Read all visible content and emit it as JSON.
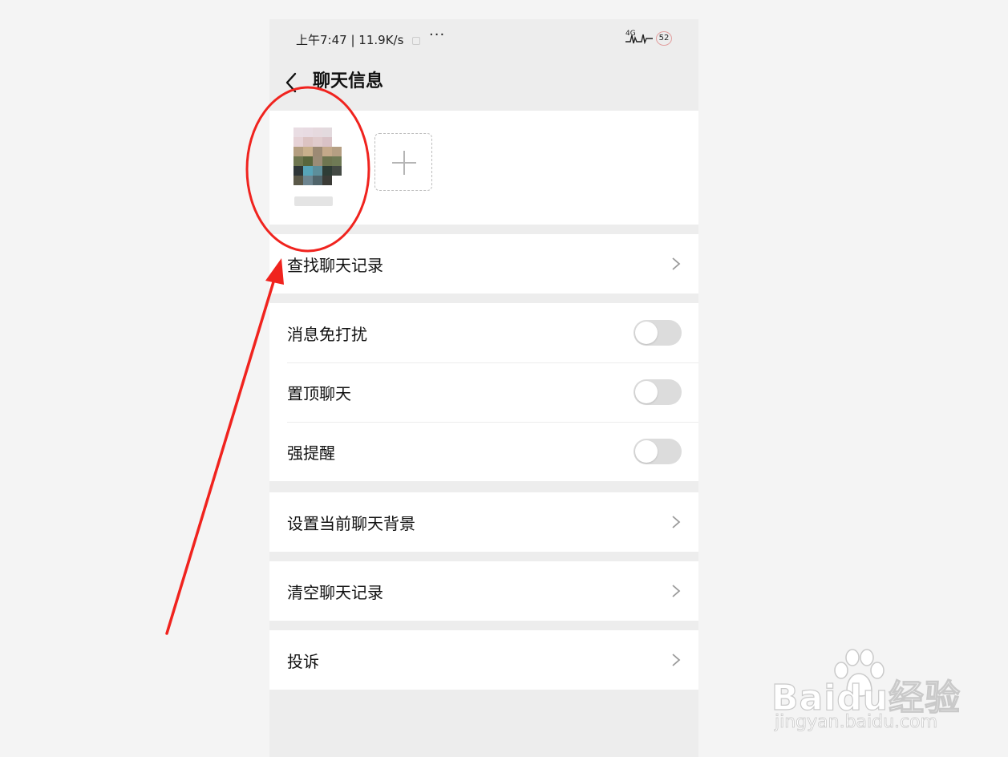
{
  "statusbar": {
    "time": "上午7:47",
    "network_speed": "11.9K/s",
    "more": "···",
    "signal": "4G",
    "battery": "52"
  },
  "navbar": {
    "title": "聊天信息"
  },
  "members": {
    "avatar_colors": [
      "#ffffff",
      "#e9dde3",
      "#e8dbe2",
      "#e6d9de",
      "#e3dade",
      "#ffffff",
      "#ffffff",
      "#e6d2d6",
      "#dcc3c2",
      "#e0cbcc",
      "#d9c2c6",
      "#ffffff",
      "#ffffff",
      "#b49e80",
      "#c9b08c",
      "#9c8a74",
      "#c4a98a",
      "#b59f83",
      "#ffffff",
      "#6e7650",
      "#59663d",
      "#9b8c77",
      "#6e7550",
      "#6f7a55",
      "#ffffff",
      "#2e3638",
      "#57a4b8",
      "#5d8e9a",
      "#2e3c35",
      "#444a44",
      "#ffffff",
      "#5a5848",
      "#6d8590",
      "#50646a",
      "#3b3b36",
      "#ffffff"
    ]
  },
  "settings": {
    "search_history": "查找聊天记录",
    "mute": "消息免打扰",
    "pin": "置顶聊天",
    "strong_remind": "强提醒",
    "background": "设置当前聊天背景",
    "clear_history": "清空聊天记录",
    "report": "投诉"
  },
  "toggles": {
    "mute": false,
    "pin": false,
    "strong_remind": false
  },
  "colors": {
    "annotation": "#f0231e",
    "toggle_off": "#dcdcdc",
    "page_bg": "#ededed"
  },
  "watermark": {
    "brand": "Baidu经验",
    "url": "jingyan.baidu.com"
  }
}
